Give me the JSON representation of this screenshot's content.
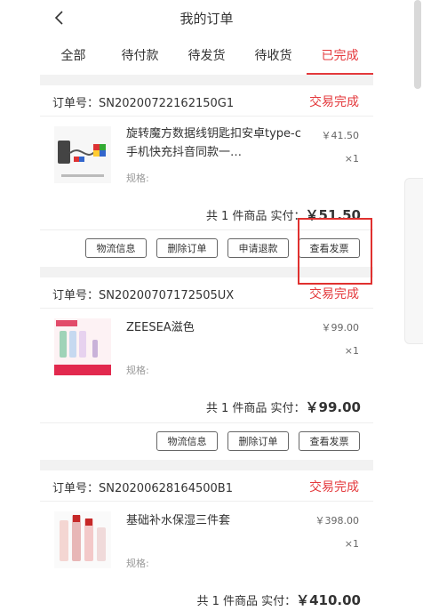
{
  "header": {
    "title": "我的订单"
  },
  "tabs": [
    {
      "label": "全部"
    },
    {
      "label": "待付款"
    },
    {
      "label": "待发货"
    },
    {
      "label": "待收货"
    },
    {
      "label": "已完成"
    }
  ],
  "active_tab_index": 4,
  "order_no_label": "订单号：",
  "orders": [
    {
      "order_no": "SN20200722162150G1",
      "status": "交易完成",
      "product": {
        "name": "旋转魔方数据线钥匙扣安卓type-c手机快充抖音同款一…",
        "spec": "规格:",
        "price": "￥41.50",
        "qty": "×1"
      },
      "summary": {
        "text": "共 1 件商品 实付：",
        "amount": "￥51.50"
      },
      "buttons": [
        "物流信息",
        "删除订单",
        "申请退款",
        "查看发票"
      ]
    },
    {
      "order_no": "SN20200707172505UX",
      "status": "交易完成",
      "product": {
        "name": "ZEESEA滋色",
        "spec": "规格:",
        "price": "￥99.00",
        "qty": "×1"
      },
      "summary": {
        "text": "共 1 件商品 实付：",
        "amount": "￥99.00"
      },
      "buttons": [
        "物流信息",
        "删除订单",
        "查看发票"
      ]
    },
    {
      "order_no": "SN20200628164500B1",
      "status": "交易完成",
      "product": {
        "name": "基础补水保湿三件套",
        "spec": "规格:",
        "price": "￥398.00",
        "qty": "×1"
      },
      "summary": {
        "text": "共 1 件商品 实付：",
        "amount": "￥410.00"
      }
    }
  ],
  "colors": {
    "accent": "#e4393c",
    "background": "#f2f2f2"
  }
}
